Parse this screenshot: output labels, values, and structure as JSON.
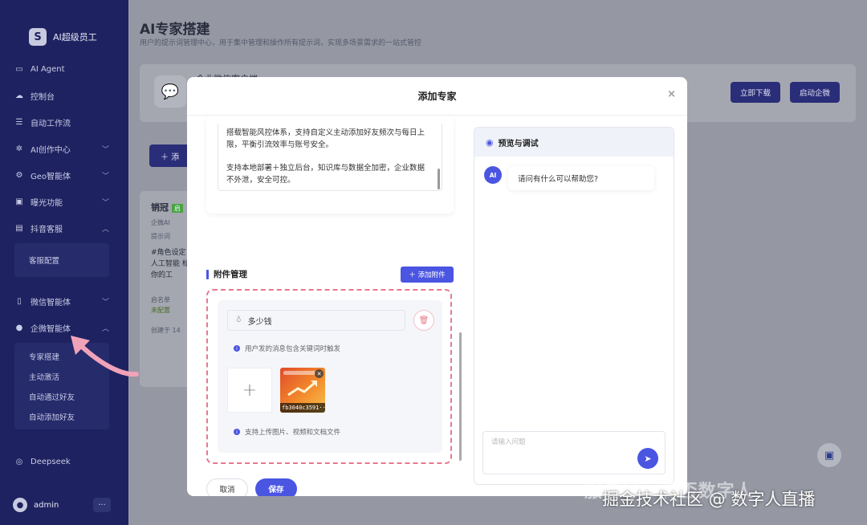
{
  "sidebar": {
    "brand": "AI超级员工",
    "items": [
      {
        "label": "AI Agent",
        "icon": "monitor-icon"
      },
      {
        "label": "控制台",
        "icon": "cloud-icon"
      },
      {
        "label": "自动工作流",
        "icon": "stack-icon"
      },
      {
        "label": "AI创作中心",
        "icon": "sparkle-icon",
        "chevron": "﹀"
      },
      {
        "label": "Geo智能体",
        "icon": "gear-icon",
        "chevron": "﹀"
      },
      {
        "label": "曝光功能",
        "icon": "image-icon",
        "chevron": "﹀"
      },
      {
        "label": "抖音客服",
        "icon": "chat-icon",
        "chevron": "︿"
      }
    ],
    "douyin_sub": [
      "客服配置"
    ],
    "items2": [
      {
        "label": "微信智能体",
        "icon": "phone-icon",
        "chevron": "﹀"
      },
      {
        "label": "企微智能体",
        "icon": "user-icon",
        "chevron": "︿"
      }
    ],
    "qiwei_sub": [
      "专家搭建",
      "主动激活",
      "自动通过好友",
      "自动添加好友"
    ],
    "deepseek": "Deepseek",
    "user": "admin",
    "more": "···"
  },
  "main": {
    "title": "AI专家搭建",
    "subtitle": "用户的提示词管理中心，用于集中管理和操作所有提示词，实现多场景需求的一站式管控",
    "card_title": "企业微信客户端",
    "download_btn": "立即下载",
    "launch_btn": "启动企微",
    "add_btn": "＋ 添",
    "expert_name": "销冠",
    "expert_badge": "启",
    "expert_line1": "企微AI",
    "expert_line2": "提示词",
    "expert_prompt": "#角色设定 人工智能 标 你的工",
    "expert_status1": "启名单",
    "expert_status2": "未配置",
    "expert_footer": "创建于 14"
  },
  "modal": {
    "title": "添加专家",
    "close": "×",
    "description_p1": "搭载智能风控体系，支持自定义主动添加好友频次与每日上限，平衡引流效率与账号安全。",
    "description_p2": "支持本地部署＋独立后台，知识库与数据全加密，企业数据不外泄，安全可控。",
    "attachment_title": "附件管理",
    "add_attachment": "＋ 添加附件",
    "keyword": "多少钱",
    "keyword_hint": "用户发的消息包含关键词时触发",
    "upload_hint": "支持上传图片、视频和文档文件",
    "thumb_caption": "fb3040c3591···",
    "cancel": "取消",
    "save": "保存"
  },
  "preview": {
    "title": "预览与调试",
    "ai_label": "AI",
    "greeting": "请问有什么可以帮助您?",
    "input_placeholder": "请输入问题"
  },
  "watermark": {
    "line1": "服务号 · 青否数字人",
    "line2": "掘金技术社区 @ 数字人直播"
  },
  "colors": {
    "primary": "#4a55e2",
    "sidebar": "#1e2260",
    "dashed": "#e8788e",
    "arrow": "#f0a3b8"
  }
}
